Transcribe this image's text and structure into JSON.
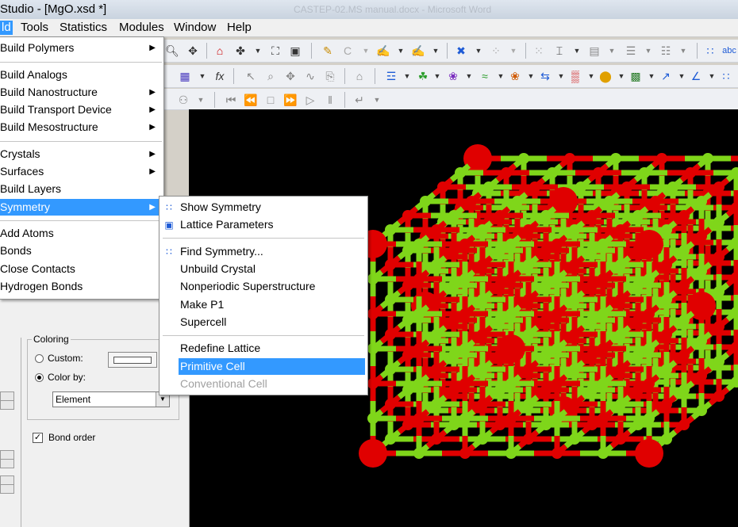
{
  "window": {
    "title": "Studio - [MgO.xsd *]",
    "faint_title": "CASTEP-02.MS manual.docx - Microsoft Word"
  },
  "menubar": {
    "build": "ld",
    "tools": "Tools",
    "statistics": "Statistics",
    "modules": "Modules",
    "window": "Window",
    "help": "Help"
  },
  "build_menu": {
    "items": [
      "Build Polymers",
      "Build Analogs",
      "Build Nanostructure",
      "Build Transport Device",
      "Build Mesostructure",
      "Crystals",
      "Surfaces",
      "Build Layers",
      "Symmetry",
      "Add Atoms",
      "Bonds",
      "Close Contacts",
      "Hydrogen Bonds"
    ]
  },
  "symmetry_menu": {
    "items": [
      "Show Symmetry",
      "Lattice Parameters",
      "Find Symmetry...",
      "Unbuild Crystal",
      "Nonperiodic Superstructure",
      "Make P1",
      "Supercell",
      "Redefine Lattice",
      "Primitive Cell",
      "Conventional Cell"
    ]
  },
  "display_style": {
    "coloring_label": "Coloring",
    "custom_label": "Custom:",
    "color_by_label": "Color by:",
    "color_by_value": "Element",
    "bond_order_label": "Bond order"
  },
  "colors": {
    "highlight": "#3399ff",
    "oxygen": "#e00000",
    "magnesium": "#7fd61a",
    "viewport_bg": "#000000"
  }
}
